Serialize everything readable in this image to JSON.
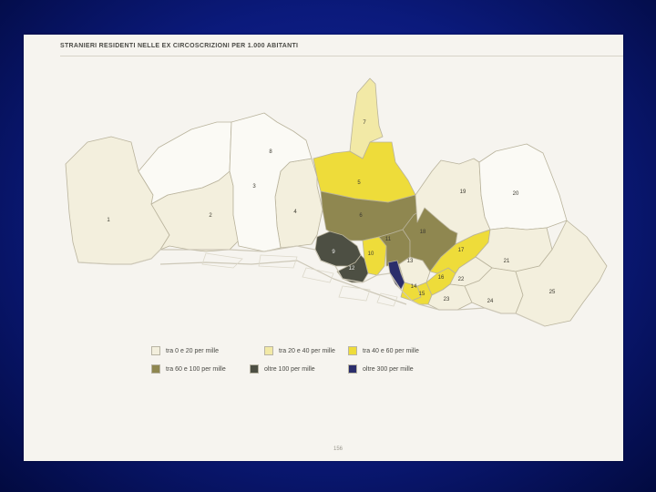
{
  "title": "STRANIERI RESIDENTI NELLE EX CIRCOSCRIZIONI PER 1.000 ABITANTI",
  "page_number": "156",
  "colors": {
    "class_0_20": "#f3efdd",
    "class_20_40": "#f2e9a6",
    "class_40_60": "#eedc3a",
    "class_60_100": "#8f8750",
    "class_100_300": "#4d4f43",
    "class_over_300": "#2b2e6b",
    "unclassified": "#fbfaf5"
  },
  "legend": [
    {
      "label": "tra 0 e 20 per mille",
      "color": "#f3efdd"
    },
    {
      "label": "tra 20 e 40 per mille",
      "color": "#f2e9a6"
    },
    {
      "label": "tra 40 e 60 per mille",
      "color": "#eedc3a"
    },
    {
      "label": "tra 60 e 100 per mille",
      "color": "#8f8750"
    },
    {
      "label": "oltre 100 per mille",
      "color": "#4d4f43"
    },
    {
      "label": "oltre 300 per mille",
      "color": "#2b2e6b"
    }
  ],
  "districts": [
    {
      "id": "1",
      "class": "class_0_20"
    },
    {
      "id": "2",
      "class": "class_0_20"
    },
    {
      "id": "3",
      "class": "unclassified"
    },
    {
      "id": "4",
      "class": "class_0_20"
    },
    {
      "id": "5",
      "class": "class_40_60"
    },
    {
      "id": "6",
      "class": "class_60_100"
    },
    {
      "id": "7",
      "class": "class_20_40"
    },
    {
      "id": "8",
      "class": "unclassified"
    },
    {
      "id": "9",
      "class": "class_100_300"
    },
    {
      "id": "10",
      "class": "class_40_60"
    },
    {
      "id": "11",
      "class": "class_60_100"
    },
    {
      "id": "12",
      "class": "class_100_300"
    },
    {
      "id": "13",
      "class": "class_0_20"
    },
    {
      "id": "14",
      "class": "class_40_60"
    },
    {
      "id": "15",
      "class": "class_40_60"
    },
    {
      "id": "16",
      "class": "class_40_60"
    },
    {
      "id": "17",
      "class": "class_40_60"
    },
    {
      "id": "18",
      "class": "class_60_100"
    },
    {
      "id": "19",
      "class": "class_0_20"
    },
    {
      "id": "20",
      "class": "unclassified"
    },
    {
      "id": "21",
      "class": "class_0_20"
    },
    {
      "id": "22",
      "class": "class_0_20"
    },
    {
      "id": "23",
      "class": "class_0_20"
    },
    {
      "id": "24",
      "class": "class_0_20"
    },
    {
      "id": "25",
      "class": "class_0_20"
    },
    {
      "id": "centro",
      "class": "class_over_300"
    }
  ]
}
